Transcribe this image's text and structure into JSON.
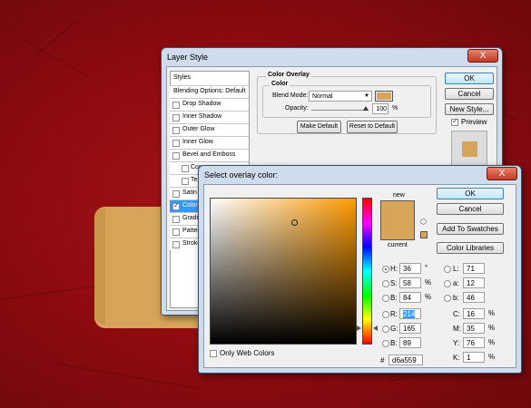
{
  "colors": {
    "overlay": "#d6a559",
    "background": "#8e0c10"
  },
  "layer_style": {
    "title": "Layer Style",
    "styles_header": "Styles",
    "blending_options": "Blending Options: Default",
    "items": [
      {
        "label": "Drop Shadow",
        "checked": false
      },
      {
        "label": "Inner Shadow",
        "checked": false
      },
      {
        "label": "Outer Glow",
        "checked": false
      },
      {
        "label": "Inner Glow",
        "checked": false
      },
      {
        "label": "Bevel and Emboss",
        "checked": false
      },
      {
        "label": "Con",
        "checked": false
      },
      {
        "label": "Tex",
        "checked": false
      },
      {
        "label": "Satin",
        "checked": false
      },
      {
        "label": "Color",
        "checked": true
      },
      {
        "label": "Gradie",
        "checked": false
      },
      {
        "label": "Patten",
        "checked": false
      },
      {
        "label": "Stroke",
        "checked": false
      }
    ],
    "group_title": "Color Overlay",
    "subgroup_title": "Color",
    "blend_mode_label": "Blend Mode:",
    "blend_mode_value": "Normal",
    "opacity_label": "Opacity:",
    "opacity_value": "100",
    "opacity_unit": "%",
    "opacity_level": 1.0,
    "make_default": "Make Default",
    "reset_default": "Reset to Default",
    "ok": "OK",
    "cancel": "Cancel",
    "new_style": "New Style...",
    "preview_label": "Preview",
    "preview_checked": true,
    "close": "X"
  },
  "color_picker": {
    "title": "Select overlay color:",
    "close": "X",
    "new_label": "new",
    "current_label": "current",
    "ok": "OK",
    "cancel": "Cancel",
    "add_swatches": "Add To Swatches",
    "color_libraries": "Color Libraries",
    "hsb": [
      {
        "label": "H:",
        "value": "36",
        "unit": "°"
      },
      {
        "label": "S:",
        "value": "58",
        "unit": "%"
      },
      {
        "label": "B:",
        "value": "84",
        "unit": "%"
      }
    ],
    "rgb": [
      {
        "label": "R:",
        "value": "214"
      },
      {
        "label": "G:",
        "value": "165"
      },
      {
        "label": "B:",
        "value": "89"
      }
    ],
    "lab": [
      {
        "label": "L:",
        "value": "71"
      },
      {
        "label": "a:",
        "value": "12"
      },
      {
        "label": "b:",
        "value": "46"
      }
    ],
    "cmyk": [
      {
        "label": "C:",
        "value": "16",
        "unit": "%"
      },
      {
        "label": "M:",
        "value": "35",
        "unit": "%"
      },
      {
        "label": "Y:",
        "value": "76",
        "unit": "%"
      },
      {
        "label": "K:",
        "value": "1",
        "unit": "%"
      }
    ],
    "hex_label": "#",
    "hex_value": "d6a559",
    "only_web_colors": "Only Web Colors"
  }
}
